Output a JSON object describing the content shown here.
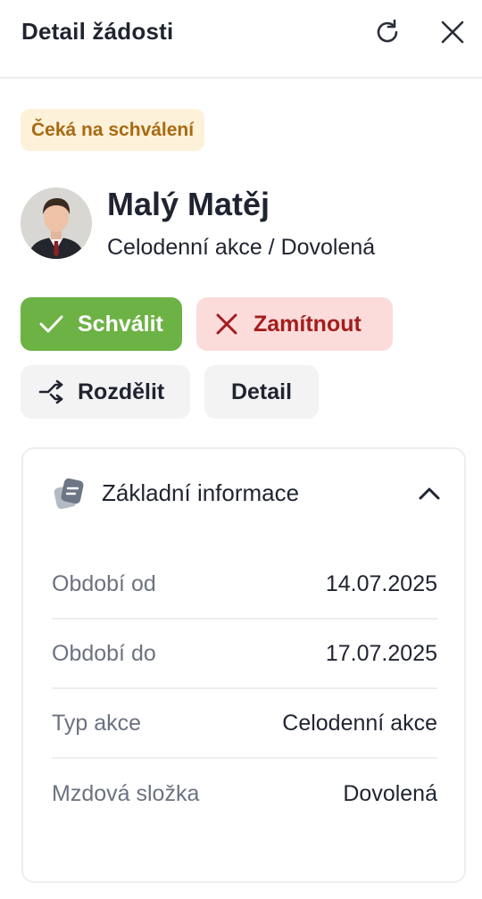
{
  "header": {
    "title": "Detail žádosti",
    "refresh_icon": "refresh-icon",
    "close_icon": "close-icon"
  },
  "status": {
    "label": "Čeká na schválení",
    "color": "#a86a12",
    "background": "#fdf1da"
  },
  "employee": {
    "name": "Malý Matěj",
    "subtitle": "Celodenní akce / Dovolená"
  },
  "actions": {
    "approve_label": "Schválit",
    "reject_label": "Zamítnout",
    "split_label": "Rozdělit",
    "detail_label": "Detail",
    "approve_color": "#6db245",
    "reject_color": "#a41d1d"
  },
  "info_card": {
    "title": "Základní informace",
    "expanded": true,
    "rows": [
      {
        "label": "Období od",
        "value": "14.07.2025"
      },
      {
        "label": "Období do",
        "value": "17.07.2025"
      },
      {
        "label": "Typ akce",
        "value": "Celodenní akce"
      },
      {
        "label": "Mzdová složka",
        "value": "Dovolená"
      }
    ]
  }
}
